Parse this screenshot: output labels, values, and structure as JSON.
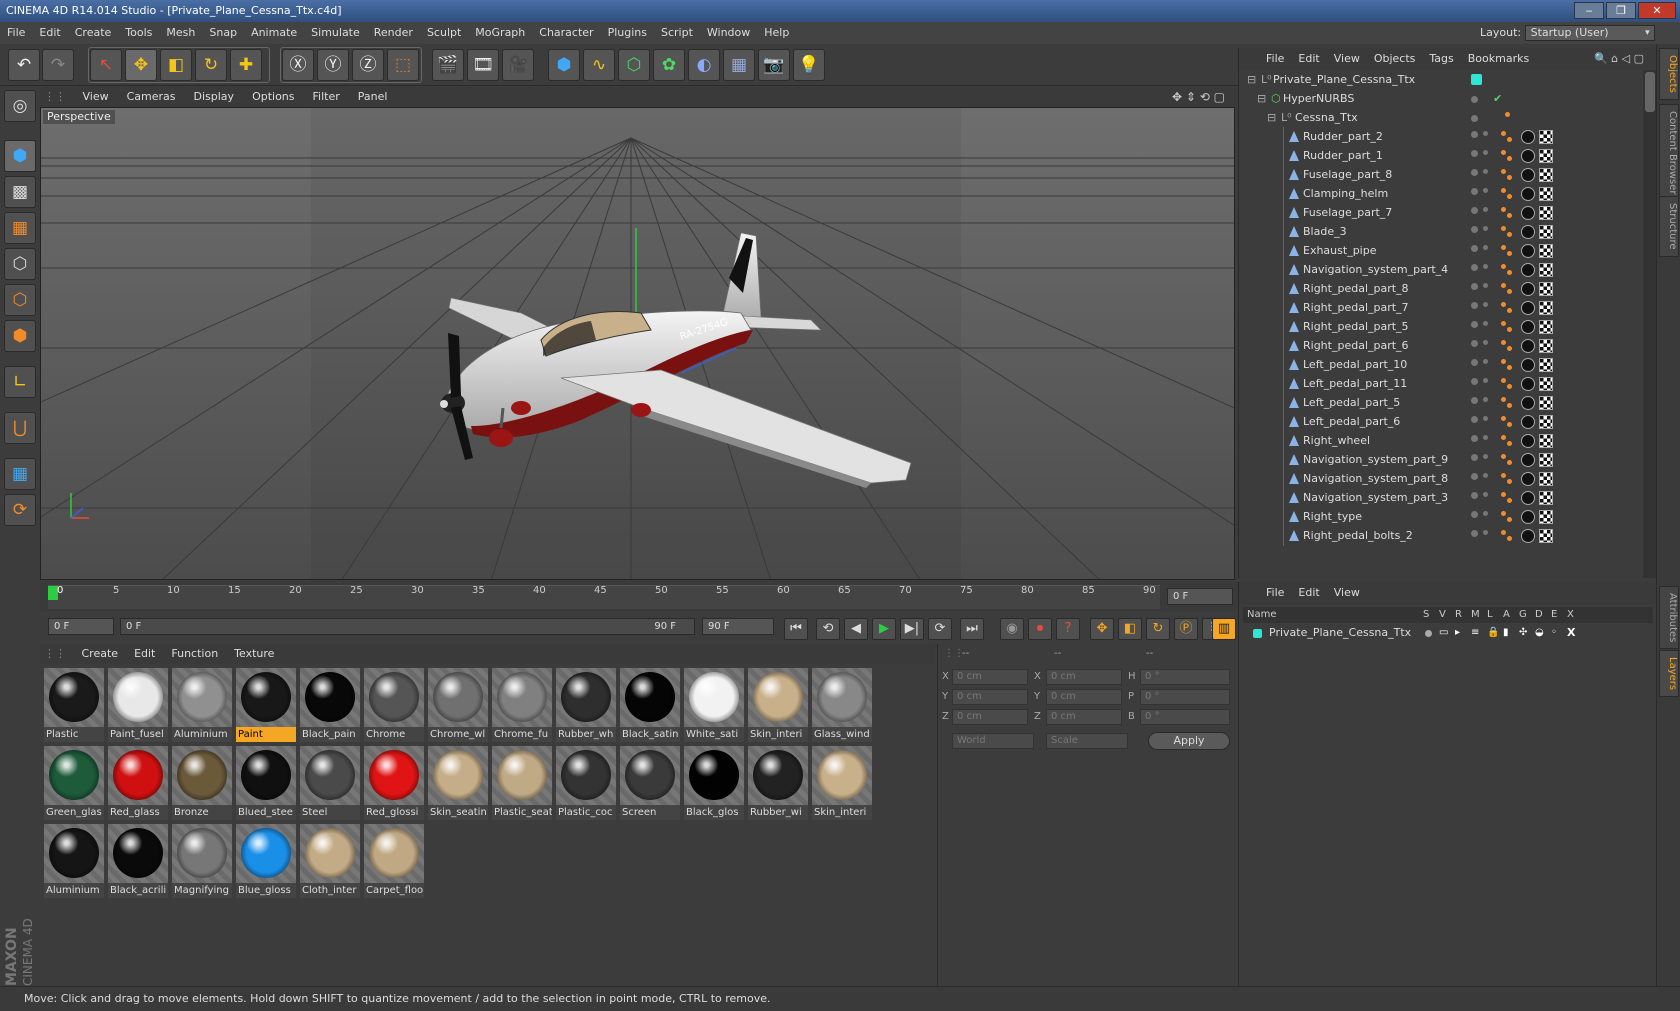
{
  "window": {
    "title": "CINEMA 4D R14.014 Studio - [Private_Plane_Cessna_Ttx.c4d]"
  },
  "menu": [
    "File",
    "Edit",
    "Create",
    "Tools",
    "Mesh",
    "Snap",
    "Animate",
    "Simulate",
    "Render",
    "Sculpt",
    "MoGraph",
    "Character",
    "Plugins",
    "Script",
    "Window",
    "Help"
  ],
  "layout": {
    "label": "Layout:",
    "value": "Startup (User)"
  },
  "viewport": {
    "menu": [
      "View",
      "Cameras",
      "Display",
      "Options",
      "Filter",
      "Panel"
    ],
    "label": "Perspective",
    "plane_reg": "RA-2754G"
  },
  "timeline": {
    "ticks": [
      "0",
      "5",
      "10",
      "15",
      "20",
      "25",
      "30",
      "35",
      "40",
      "45",
      "50",
      "55",
      "60",
      "65",
      "70",
      "75",
      "80",
      "85",
      "90"
    ],
    "current": "0 F",
    "start": "0 F",
    "range_start": "0 F",
    "range_end": "90 F",
    "end": "90 F"
  },
  "materials": {
    "menu": [
      "Create",
      "Edit",
      "Function",
      "Texture"
    ],
    "items": [
      {
        "name": "Plastic",
        "color": "#1a1a1a"
      },
      {
        "name": "Paint_fusel",
        "color": "#e8e8e8"
      },
      {
        "name": "Aluminium",
        "color": "#909090"
      },
      {
        "name": "Paint",
        "color": "#181818",
        "active": true
      },
      {
        "name": "Black_pain",
        "color": "#080808"
      },
      {
        "name": "Chrome",
        "color": "#555555"
      },
      {
        "name": "Chrome_wl",
        "color": "#707070"
      },
      {
        "name": "Chrome_fu",
        "color": "#808080"
      },
      {
        "name": "Rubber_wh",
        "color": "#2e2e2e"
      },
      {
        "name": "Black_satin",
        "color": "#050505"
      },
      {
        "name": "White_sati",
        "color": "#f2f2f2"
      },
      {
        "name": "Skin_interi",
        "color": "#c8b08a"
      },
      {
        "name": "Glass_wind",
        "color": "#888888"
      },
      {
        "name": "Green_glas",
        "color": "#1d5b3a"
      },
      {
        "name": "Red_glass",
        "color": "#d01010"
      },
      {
        "name": "Bronze",
        "color": "#6b5a3a"
      },
      {
        "name": "Blued_stee",
        "color": "#101010"
      },
      {
        "name": "Steel",
        "color": "#4a4a4a"
      },
      {
        "name": "Red_glossi",
        "color": "#e01414"
      },
      {
        "name": "Skin_seatin",
        "color": "#c4ad88"
      },
      {
        "name": "Plastic_seat",
        "color": "#c0a985"
      },
      {
        "name": "Plastic_coc",
        "color": "#333333"
      },
      {
        "name": "Screen",
        "color": "#3a3a3a"
      },
      {
        "name": "Black_glos",
        "color": "#020202"
      },
      {
        "name": "Rubber_wi",
        "color": "#222222"
      },
      {
        "name": "Skin_interi",
        "color": "#c8b08a"
      },
      {
        "name": "Aluminium",
        "color": "#151515"
      },
      {
        "name": "Black_acrili",
        "color": "#0a0a0a"
      },
      {
        "name": "Magnifying",
        "color": "#777777"
      },
      {
        "name": "Blue_gloss",
        "color": "#1a8fe8"
      },
      {
        "name": "Cloth_inter",
        "color": "#c2ab86"
      },
      {
        "name": "Carpet_floo",
        "color": "#bfa883"
      }
    ]
  },
  "coordinates": {
    "headers": [
      "--",
      "--",
      "--"
    ],
    "rows": [
      {
        "a": "X",
        "av": "0 cm",
        "b": "X",
        "bv": "0 cm",
        "c": "H",
        "cv": "0 °"
      },
      {
        "a": "Y",
        "av": "0 cm",
        "b": "Y",
        "bv": "0 cm",
        "c": "P",
        "cv": "0 °"
      },
      {
        "a": "Z",
        "av": "0 cm",
        "b": "Z",
        "bv": "0 cm",
        "c": "B",
        "cv": "0 °"
      }
    ],
    "world": "World",
    "scale": "Scale",
    "apply": "Apply"
  },
  "objects": {
    "menu": [
      "File",
      "Edit",
      "View",
      "Objects",
      "Tags",
      "Bookmarks"
    ],
    "root": "Private_Plane_Cessna_Ttx",
    "hypernurbs": "HyperNURBS",
    "group": "Cessna_Ttx",
    "items": [
      "Rudder_part_2",
      "Rudder_part_1",
      "Fuselage_part_8",
      "Clamping_helm",
      "Fuselage_part_7",
      "Blade_3",
      "Exhaust_pipe",
      "Navigation_system_part_4",
      "Right_pedal_part_8",
      "Right_pedal_part_7",
      "Right_pedal_part_5",
      "Right_pedal_part_6",
      "Left_pedal_part_10",
      "Left_pedal_part_11",
      "Left_pedal_part_5",
      "Left_pedal_part_6",
      "Right_wheel",
      "Navigation_system_part_9",
      "Navigation_system_part_8",
      "Navigation_system_part_3",
      "Right_type",
      "Right_pedal_bolts_2"
    ]
  },
  "layers": {
    "menu": [
      "File",
      "Edit",
      "View"
    ],
    "columns": [
      "Name",
      "S",
      "V",
      "R",
      "M",
      "L",
      "A",
      "G",
      "D",
      "E",
      "X"
    ],
    "row": "Private_Plane_Cessna_Ttx"
  },
  "sidetabs": {
    "objects": "Objects",
    "content": "Content Browser",
    "structure": "Structure",
    "attributes": "Attributes",
    "layers": "Layers"
  },
  "brand": {
    "maxon": "MAXON",
    "cinema": "CINEMA 4D"
  },
  "status": "Move: Click and drag to move elements. Hold down SHIFT to quantize movement / add to the selection in point mode, CTRL to remove."
}
